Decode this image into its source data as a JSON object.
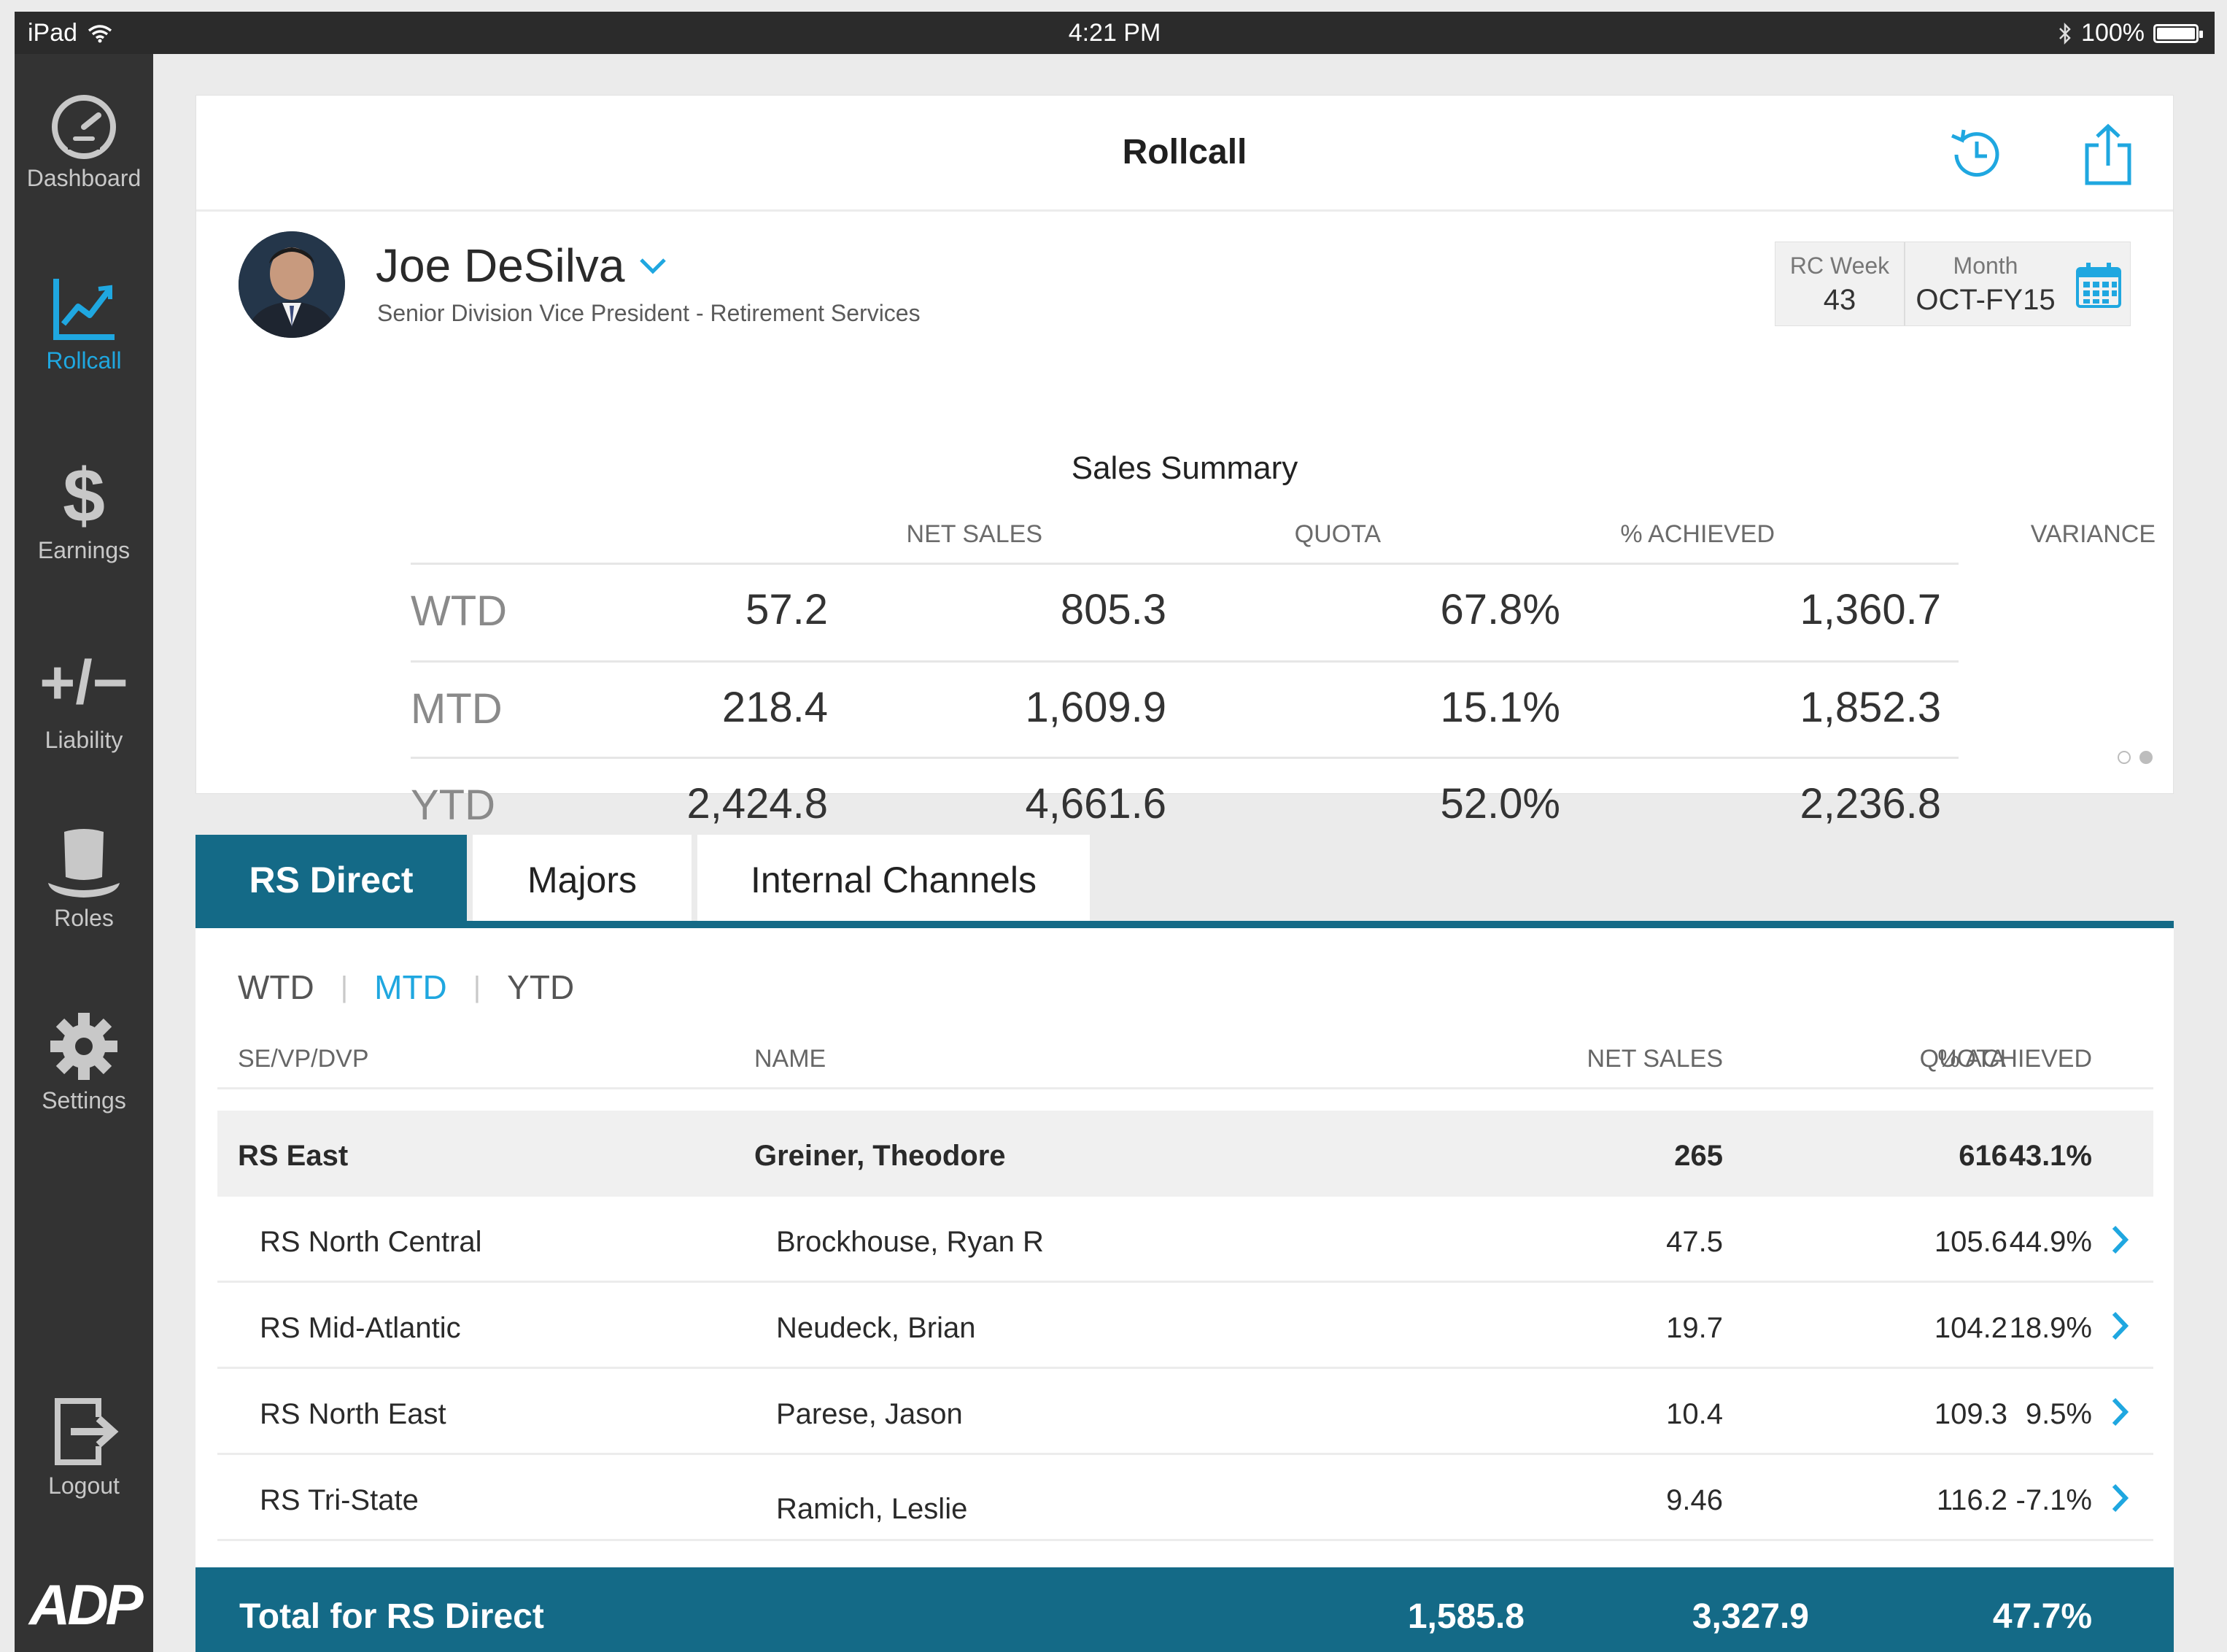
{
  "status_bar": {
    "device": "iPad",
    "time": "4:21 PM",
    "battery": "100%",
    "battery_level": 1.0
  },
  "nav": {
    "items": [
      {
        "label": "Dashboard",
        "icon": "speedometer-icon",
        "active": false
      },
      {
        "label": "Rollcall",
        "icon": "line-chart-icon",
        "active": true
      },
      {
        "label": "Earnings",
        "icon": "dollar-icon",
        "active": false
      },
      {
        "label": "Liability",
        "icon": "plus-minus-icon",
        "active": false
      },
      {
        "label": "Roles",
        "icon": "top-hat-icon",
        "active": false
      },
      {
        "label": "Settings",
        "icon": "gear-icon",
        "active": false
      },
      {
        "label": "Logout",
        "icon": "logout-icon",
        "active": false
      }
    ],
    "logo": "ADP"
  },
  "header": {
    "title": "Rollcall",
    "history_icon": "history-icon",
    "share_icon": "share-icon"
  },
  "profile": {
    "name": "Joe DeSilva",
    "role": "Senior Division Vice President - Retirement Services"
  },
  "period": {
    "week_label": "RC Week",
    "week_value": "43",
    "month_label": "Month",
    "month_value": "OCT-FY15"
  },
  "summary": {
    "title": "Sales Summary",
    "columns": [
      "NET SALES",
      "QUOTA",
      "% ACHIEVED",
      "VARIANCE"
    ],
    "rows": [
      {
        "label": "WTD",
        "values": [
          "57.2",
          "805.3",
          "67.8%",
          "1,360.7"
        ]
      },
      {
        "label": "MTD",
        "values": [
          "218.4",
          "1,609.9",
          "15.1%",
          "1,852.3"
        ]
      },
      {
        "label": "YTD",
        "values": [
          "2,424.8",
          "4,661.6",
          "52.0%",
          "2,236.8"
        ]
      }
    ],
    "page_index": 2,
    "page_count": 2
  },
  "tabs": [
    {
      "label": "RS Direct",
      "active": true
    },
    {
      "label": "Majors",
      "active": false
    },
    {
      "label": "Internal Channels",
      "active": false
    }
  ],
  "period_filter": {
    "options": [
      "WTD",
      "MTD",
      "YTD"
    ],
    "selected": "MTD"
  },
  "table": {
    "columns": [
      "SE/VP/DVP",
      "NAME",
      "NET SALES",
      "QUOTA",
      "% ACHIEVED"
    ],
    "group": {
      "region": "RS East",
      "name": "Greiner, Theodore",
      "net_sales": "265",
      "quota": "616",
      "achieved": "43.1%"
    },
    "rows": [
      {
        "region": "RS North Central",
        "name": "Brockhouse, Ryan R",
        "net_sales": "47.5",
        "quota": "105.6",
        "achieved": "44.9%"
      },
      {
        "region": "RS Mid-Atlantic",
        "name": "Neudeck, Brian",
        "net_sales": "19.7",
        "quota": "104.2",
        "achieved": "18.9%"
      },
      {
        "region": "RS North East",
        "name": "Parese, Jason",
        "net_sales": "10.4",
        "quota": "109.3",
        "achieved": "9.5%"
      },
      {
        "region": "RS Tri-State",
        "name": "Ramich, Leslie",
        "net_sales": "9.46",
        "quota": "116.2",
        "achieved": "-7.1%"
      }
    ],
    "total": {
      "label": "Total for RS Direct",
      "net_sales": "1,585.8",
      "quota": "3,327.9",
      "achieved": "47.7%"
    }
  },
  "colors": {
    "accent": "#1fa7e0",
    "teal": "#146a87",
    "sidebar": "#333333"
  }
}
